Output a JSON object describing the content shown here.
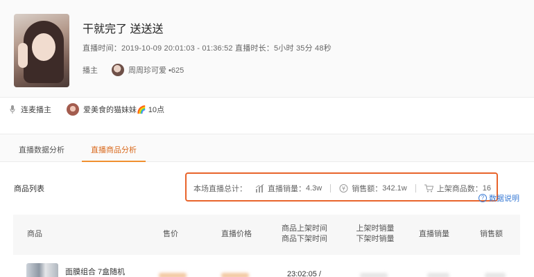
{
  "live": {
    "title": "干就完了 送送送",
    "meta": "直播时间：2019-10-09 20:01:03 - 01:36:52 直播时长：5小时 35分 48秒",
    "anchor_label": "播主",
    "anchor_name": "周周珍可爱 •625"
  },
  "co_host": {
    "label": "连麦播主",
    "name": "爱美食的猫妹妹🌈 10点"
  },
  "tabs": [
    {
      "label": "直播数据分析",
      "active": false
    },
    {
      "label": "直播商品分析",
      "active": true
    }
  ],
  "product_list": {
    "label": "商品列表",
    "stats_prefix": "本场直播总计：",
    "sales_volume_label": "直播销量：",
    "sales_volume": "4.3w",
    "sales_amount_label": "销售额：",
    "sales_amount": "342.1w",
    "listed_label": "上架商品数：",
    "listed_count": "16",
    "help_label": "数据说明"
  },
  "table": {
    "columns": {
      "product": "商品",
      "price": "售价",
      "live_price": "直播价格",
      "on_time": "商品上架时间",
      "off_time": "商品下架时间",
      "on_sales": "上架时销量",
      "off_sales": "下架时销量",
      "live_sales": "直播销量",
      "amount": "销售额"
    },
    "rows": [
      {
        "name": "面膜组合 7盒随机",
        "on_time": "23:02:05 /"
      }
    ]
  },
  "colors": {
    "accent": "#d96a1e",
    "highlight_box": "#e8632a",
    "link": "#3a7bd5"
  }
}
